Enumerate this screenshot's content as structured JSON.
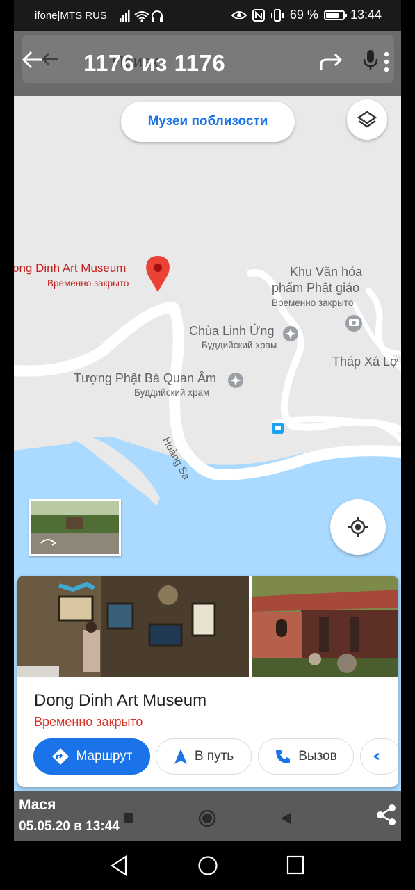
{
  "status_bar": {
    "carrier": "ifone|MTS RUS",
    "battery_percent": "69 %",
    "battery_level": 0.69,
    "time": "13:44"
  },
  "viewer": {
    "counter": "1176 из 1176",
    "search_placeholder_ghost": "Поиск"
  },
  "map": {
    "nearby_button": "Музеи поблизости",
    "labels": {
      "museum_name": "ong Dinh Art Museum",
      "museum_status": "Временно закрыто",
      "khu_line1": "Khu Văn hóa",
      "khu_line2": "phẩm Phật giáo",
      "khu_status": "Временно закрыто",
      "chua_name": "Chùa Linh Ứng",
      "chua_type": "Буддийский храм",
      "thap_name": "Tháp Xá Lợ",
      "tuong_name": "Tượng Phật Bà Quan Âm",
      "tuong_type": "Буддийский храм",
      "road_name": "Hoàng Sa"
    }
  },
  "place_card": {
    "title": "Dong Dinh Art Museum",
    "status": "Временно закрыто",
    "actions": {
      "route": "Маршрут",
      "start": "В путь",
      "call": "Вызов"
    }
  },
  "viewer_info": {
    "author": "Мася",
    "date": "05.05.20 в 13:44"
  },
  "colors": {
    "accent_blue": "#1a73e8",
    "closed_red": "#d93025",
    "pin_red": "#ea4335",
    "water": "#aadaff",
    "map_bg": "#e9e9e9"
  }
}
